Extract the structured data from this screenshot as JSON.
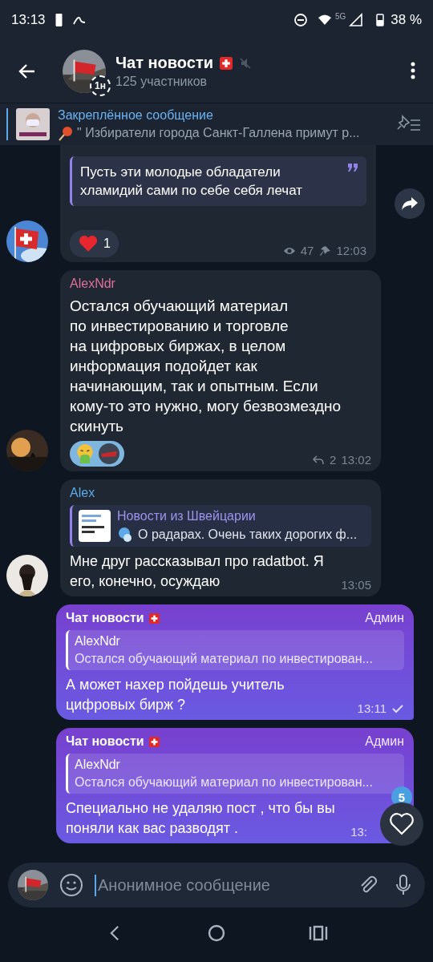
{
  "status_bar": {
    "time": "13:13",
    "network": "5G",
    "battery": "38 %"
  },
  "header": {
    "title": "Чат новости",
    "subtitle": "125 участников",
    "avatar_badge": "1н",
    "muted": true
  },
  "pinned": {
    "title": "Закреплённое сообщение",
    "text": "\" Избиратели города Санкт-Галлена примут р..."
  },
  "messages": [
    {
      "kind": "incoming",
      "quote": "Пусть эти молодые обладатели хламидий сами по себе себя лечат",
      "reactions": [
        {
          "kind": "heart",
          "count": "1"
        }
      ],
      "views": "47",
      "pinned": true,
      "time": "12:03",
      "forward": true
    },
    {
      "kind": "incoming",
      "sender": "AlexNdr",
      "color": "#e0709a",
      "text": "Остался обучающий материал\nпо инвестированию и торговле\nна цифровых биржах, в целом\nинформация подойдет как\nначинающим, так и опытным. Если\nкому-то это нужно, могу безвозмездно\nскинуть",
      "reactions": [
        {
          "kind": "sick"
        },
        {
          "kind": "avatar"
        }
      ],
      "replies": "2",
      "time": "13:02"
    },
    {
      "kind": "incoming",
      "sender": "Alex",
      "color": "#5ea9e8",
      "reply": {
        "author": "Новости из Швейцарии",
        "text": "О радарах. Очень таких дорогих ф...",
        "thumbnail": true
      },
      "text": "Мне друг рассказывал про radatbot. Я его, конечно, осуждаю",
      "time": "13:05"
    },
    {
      "kind": "outgoing",
      "sender": "Чат новости",
      "role": "Админ",
      "reply": {
        "author": "AlexNdr",
        "text": "Остался обучающий материал по инвестирован..."
      },
      "text": "А может нахер пойдешь учитель цифровых бирж ?",
      "time": "13:11",
      "sent": true
    },
    {
      "kind": "outgoing",
      "sender": "Чат новости",
      "role": "Админ",
      "reply": {
        "author": "AlexNdr",
        "text": "Остался обучающий материал по инвестирован..."
      },
      "text": "Специально не удаляю пост , что бы вы поняли как вас разводят .",
      "time": "13:"
    }
  ],
  "reaction_button": {
    "count": "5"
  },
  "composer": {
    "placeholder": "Анонимное сообщение"
  }
}
